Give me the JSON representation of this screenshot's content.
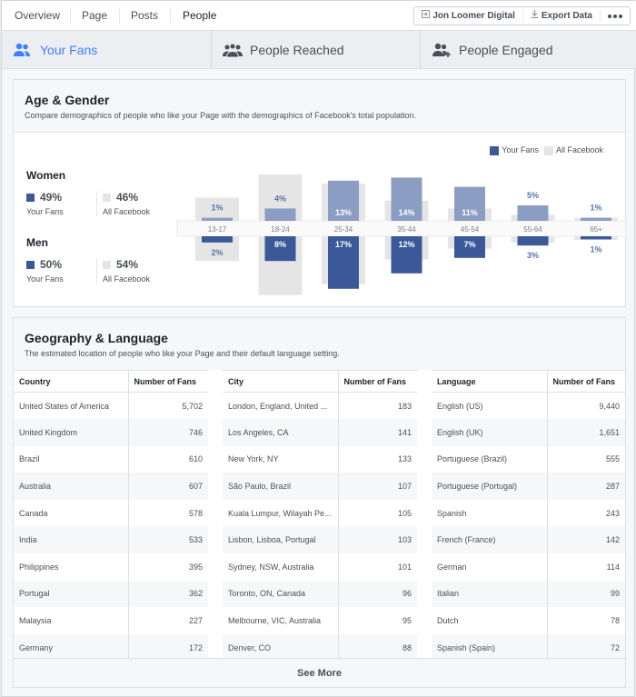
{
  "topnav": {
    "tabs": [
      {
        "label": "Overview",
        "active": false
      },
      {
        "label": "Page",
        "active": false
      },
      {
        "label": "Posts",
        "active": false
      },
      {
        "label": "People",
        "active": true
      }
    ],
    "tools": {
      "page_label": "Jon Loomer Digital",
      "page_icon": "switch-page-icon",
      "export_label": "Export Data",
      "export_icon": "download-icon",
      "more_icon": "more-dots-icon"
    }
  },
  "subtabs": [
    {
      "label": "Your Fans",
      "icon": "people-icon",
      "active": true
    },
    {
      "label": "People Reached",
      "icon": "group-icon",
      "active": false
    },
    {
      "label": "People Engaged",
      "icon": "people-add-icon",
      "active": false
    }
  ],
  "colors": {
    "accent": "#4080ff",
    "fans_women": "#8b9dc3",
    "fans_men": "#3b5998",
    "all_facebook": "#e5e5e5"
  },
  "age_gender": {
    "title": "Age & Gender",
    "subtitle": "Compare demographics of people who like your Page with the demographics of Facebook's total population.",
    "women": {
      "label": "Women",
      "fans_pct": "49%",
      "fans_label": "Your Fans",
      "all_pct": "46%",
      "all_label": "All Facebook"
    },
    "men": {
      "label": "Men",
      "fans_pct": "50%",
      "fans_label": "Your Fans",
      "all_pct": "54%",
      "all_label": "All Facebook"
    },
    "legend": {
      "fans": "Your Fans",
      "all": "All Facebook"
    }
  },
  "chart_data": {
    "type": "bar",
    "title": "Age & Gender",
    "categories": [
      "13-17",
      "18-24",
      "25-34",
      "35-44",
      "45-54",
      "55-64",
      "65+"
    ],
    "series": [
      {
        "name": "Your Fans - Women",
        "values": [
          1,
          4,
          13,
          14,
          11,
          5,
          1
        ],
        "labels": [
          "1%",
          "4%",
          "13%",
          "14%",
          "11%",
          "5%",
          "1%"
        ]
      },
      {
        "name": "Your Fans - Men",
        "values": [
          2,
          8,
          17,
          12,
          7,
          3,
          1
        ],
        "labels": [
          "2%",
          "8%",
          "17%",
          "12%",
          "7%",
          "3%",
          "1%"
        ]
      },
      {
        "name": "All Facebook - Women",
        "values": [
          7.5,
          15,
          12,
          6.5,
          4,
          2,
          1
        ]
      },
      {
        "name": "All Facebook - Men",
        "values": [
          8,
          19,
          15.5,
          7.5,
          4,
          2,
          1.2
        ]
      }
    ],
    "legend": [
      "Your Fans",
      "All Facebook"
    ],
    "legend_position": "top-right",
    "layout": "mirrored (women above, men below)",
    "grid": false
  },
  "geography": {
    "title": "Geography & Language",
    "subtitle": "The estimated location of people who like your Page and their default language setting.",
    "see_more": "See More",
    "tables": [
      {
        "headers": [
          "Country",
          "Number of Fans"
        ],
        "rows": [
          [
            "United States of America",
            "5,702"
          ],
          [
            "United Kingdom",
            "746"
          ],
          [
            "Brazil",
            "610"
          ],
          [
            "Australia",
            "607"
          ],
          [
            "Canada",
            "578"
          ],
          [
            "India",
            "533"
          ],
          [
            "Philippines",
            "395"
          ],
          [
            "Portugal",
            "362"
          ],
          [
            "Malaysia",
            "227"
          ],
          [
            "Germany",
            "172"
          ]
        ]
      },
      {
        "headers": [
          "City",
          "Number of Fans"
        ],
        "rows": [
          [
            "London, England, United ...",
            "183"
          ],
          [
            "Los Angeles, CA",
            "141"
          ],
          [
            "New York, NY",
            "133"
          ],
          [
            "São Paulo, Brazil",
            "107"
          ],
          [
            "Kuala Lumpur, Wilayah Pe...",
            "105"
          ],
          [
            "Lisbon, Lisboa, Portugal",
            "103"
          ],
          [
            "Sydney, NSW, Australia",
            "101"
          ],
          [
            "Toronto, ON, Canada",
            "96"
          ],
          [
            "Melbourne, VIC, Australia",
            "95"
          ],
          [
            "Denver, CO",
            "88"
          ]
        ]
      },
      {
        "headers": [
          "Language",
          "Number of Fans"
        ],
        "rows": [
          [
            "English (US)",
            "9,440"
          ],
          [
            "English (UK)",
            "1,651"
          ],
          [
            "Portuguese (Brazil)",
            "555"
          ],
          [
            "Portuguese (Portugal)",
            "287"
          ],
          [
            "Spanish",
            "243"
          ],
          [
            "French (France)",
            "142"
          ],
          [
            "German",
            "114"
          ],
          [
            "Italian",
            "99"
          ],
          [
            "Dutch",
            "78"
          ],
          [
            "Spanish (Spain)",
            "72"
          ]
        ]
      }
    ]
  }
}
